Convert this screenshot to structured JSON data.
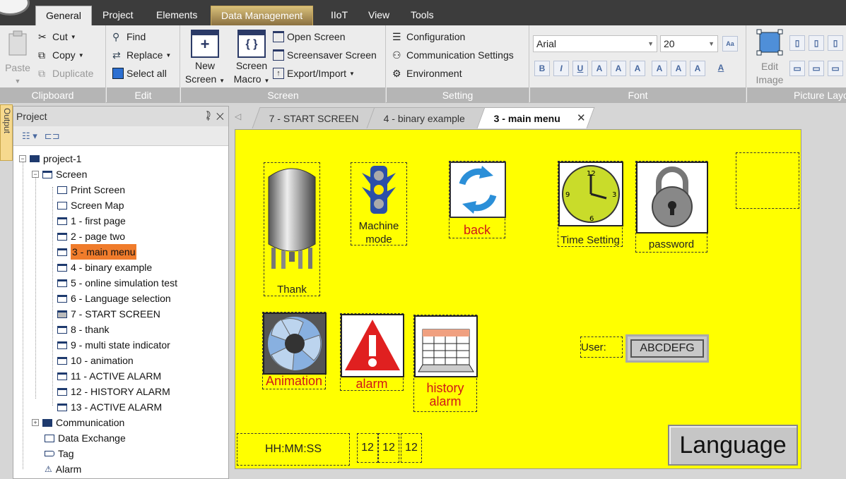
{
  "ribbon_tabs": [
    "General",
    "Project",
    "Elements",
    "Data Management",
    "IIoT",
    "View",
    "Tools"
  ],
  "clipboard": {
    "paste": "Paste",
    "cut": "Cut",
    "copy": "Copy",
    "duplicate": "Duplicate",
    "label": "Clipboard"
  },
  "edit": {
    "find": "Find",
    "replace": "Replace",
    "select_all": "Select all",
    "label": "Edit"
  },
  "screen": {
    "new_screen": [
      "New",
      "Screen"
    ],
    "screen_macro": [
      "Screen",
      "Macro"
    ],
    "open_screen": "Open Screen",
    "screensaver": "Screensaver Screen",
    "export_import": "Export/Import",
    "label": "Screen"
  },
  "setting": {
    "configuration": "Configuration",
    "communication": "Communication Settings",
    "environment": "Environment",
    "label": "Setting"
  },
  "font": {
    "family": "Arial",
    "size": "20",
    "label": "Font"
  },
  "picture": {
    "edit_image": [
      "Edit",
      "Image"
    ],
    "label": "Picture Layo"
  },
  "output_tab": "Output",
  "project_panel": {
    "title": "Project",
    "pin": "⯝",
    "close": "✕"
  },
  "tree": {
    "root": "project-1",
    "screen": "Screen",
    "items": [
      "Print Screen",
      "Screen Map",
      "1 - first page",
      "2 - page two",
      "3 - main menu",
      "4 - binary example",
      "5 - online simulation test",
      "6 - Language selection",
      "7 - START SCREEN",
      "8 - thank",
      "9 - multi state indicator",
      "10 - animation",
      "11 - ACTIVE ALARM",
      "12 - HISTORY ALARM",
      "13 - ACTIVE ALARM"
    ],
    "others": [
      "Communication",
      "Data Exchange",
      "Tag",
      "Alarm"
    ]
  },
  "doc_tabs": [
    "7 - START SCREEN",
    "4 - binary example",
    "3 - main menu"
  ],
  "canvas": {
    "thank": "Thank",
    "machine_mode": [
      "Machine",
      "mode"
    ],
    "back": "back",
    "time_setting": "Time Setting",
    "password": "password",
    "animation": "Animation",
    "alarm": "alarm",
    "history_alarm": [
      "history",
      "alarm"
    ],
    "user_label": "User:",
    "user_value": "ABCDEFG",
    "time": "HH:MM:SS",
    "date_parts": [
      "12",
      "12",
      "12"
    ],
    "language": "Language"
  }
}
